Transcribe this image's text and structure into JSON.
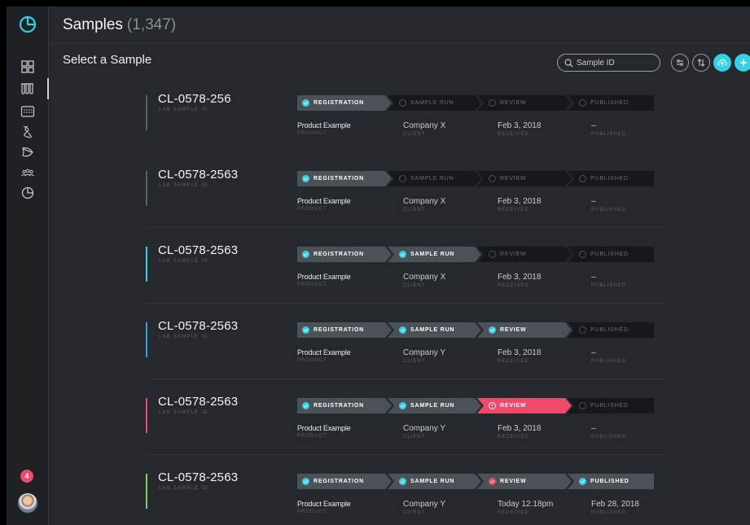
{
  "header": {
    "title": "Samples",
    "count": "(1,347)"
  },
  "subheader": {
    "title": "Select a Sample"
  },
  "search": {
    "placeholder": "Sample ID"
  },
  "sidebar": {
    "items": [
      {
        "icon": "dashboard-icon"
      },
      {
        "icon": "samples-icon",
        "active": true
      },
      {
        "icon": "plate-icon"
      },
      {
        "icon": "dna-icon"
      },
      {
        "icon": "leaf-icon"
      },
      {
        "icon": "users-icon"
      },
      {
        "icon": "reports-icon"
      }
    ],
    "notification_count": "4"
  },
  "stage_labels": [
    "Registration",
    "Sample Run",
    "Review",
    "Published"
  ],
  "field_labels": {
    "id": "LAB SAMPLE ID",
    "product": "PRODUCT",
    "client": "CLIENT",
    "received": "RECEIVED",
    "published": "PUBLISHED"
  },
  "colors": {
    "accent": "#35d1e6",
    "alert": "#ee4b6a",
    "ok": "#7bd35f"
  },
  "samples": [
    {
      "id": "CL-0578-256",
      "bar": "#5b6067",
      "stages": [
        "done",
        "pending",
        "pending",
        "pending"
      ],
      "product": "Product Example",
      "client": "Company X",
      "received": "Feb 3, 2018",
      "published": "–"
    },
    {
      "id": "CL-0578-2563",
      "bar": "#5b6067",
      "stages": [
        "done",
        "pending",
        "pending",
        "pending"
      ],
      "product": "Product Example",
      "client": "Company X",
      "received": "Feb 3, 2018",
      "published": "–"
    },
    {
      "id": "CL-0578-2563",
      "bar": "#35d1e6",
      "stages": [
        "done",
        "done",
        "pending",
        "pending"
      ],
      "product": "Product Example",
      "client": "Company X",
      "received": "Feb 3, 2018",
      "published": "–"
    },
    {
      "id": "CL-0578-2563",
      "bar": "#35a6dc",
      "stages": [
        "done",
        "done",
        "done",
        "pending"
      ],
      "product": "Product Example",
      "client": "Company Y",
      "received": "Feb 3, 2018",
      "published": "–"
    },
    {
      "id": "CL-0578-2563",
      "bar": "#ee4b6a",
      "stages": [
        "done",
        "done",
        "alert",
        "pending"
      ],
      "product": "Product Example",
      "client": "Company Y",
      "received": "Feb 3, 2018",
      "published": "–"
    },
    {
      "id": "CL-0578-2563",
      "bar": "#7bd35f",
      "stages": [
        "done",
        "done",
        "done-red",
        "done"
      ],
      "product": "Product Example",
      "client": "Company Y",
      "received": "Today 12:18pm",
      "published": "Feb 28, 2018"
    }
  ]
}
